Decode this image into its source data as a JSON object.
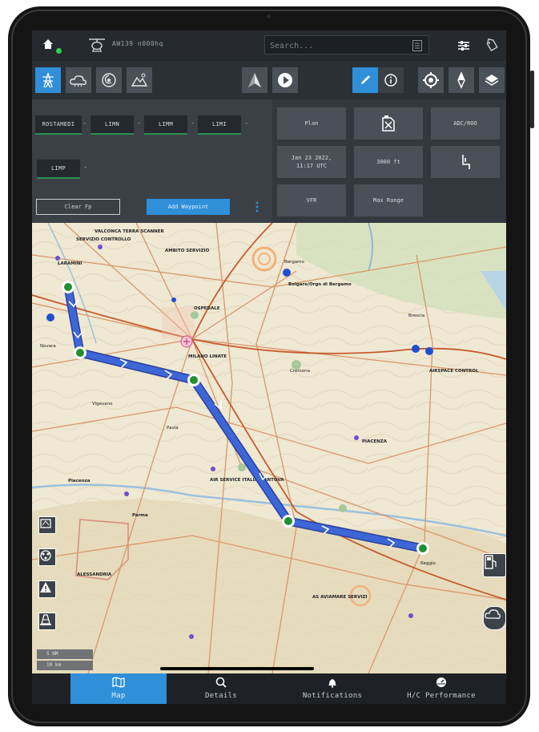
{
  "topbar": {
    "aircraft_label": "AW139 n000hq",
    "search_placeholder": "Search..."
  },
  "toolbar": {
    "icons": [
      "power-lines-icon",
      "clouds-icon",
      "hurricane-icon",
      "terrain-icon",
      "north-arrow-icon",
      "play-icon",
      "pencil-icon",
      "info-icon",
      "target-icon",
      "compass-icon",
      "layers-icon"
    ]
  },
  "route": {
    "waypoints": [
      "ROSTAMEDI",
      "LIMN",
      "LIMM",
      "LIMI",
      "LIMP"
    ],
    "clear_fp": "Clear Fp",
    "add_waypoint": "Add Waypoint"
  },
  "settings": {
    "flight_plan": "Plan",
    "date": "Jan 23 2022,",
    "time": "11:17 UTC",
    "altitude": "3000 ft",
    "rules": "VFR",
    "range": "Max Range",
    "airport_codes": "ADC/ROO"
  },
  "map": {
    "labels": [
      "VALCONCA TERRA SCANNER",
      "SERVIZIO CONTROLLO",
      "AMBITO SERVIZIO",
      "Bergamo",
      "Bolgare/Orgn di Bergamo",
      "Brescia",
      "Novara",
      "LARAMINI",
      "Vigevano",
      "Pavia",
      "OSPEDALE",
      "PIACENZA",
      "AIR SERVICE ITALIA MANTOVA",
      "MILANO LINATE",
      "Cremona",
      "Piacenza",
      "Parma",
      "AIRSPACE CONTROL",
      "ALESSANDRIA",
      "AS AVIAMARE SERVIZI",
      "Reggio"
    ],
    "scale_top": "5 NM",
    "scale_bottom": "10 km"
  },
  "nav": {
    "map": "Map",
    "details": "Details",
    "notifications": "Notifications",
    "performance": "H/C Performance"
  },
  "colors": {
    "accent": "#2f8fd8",
    "route": "#3a5fcf",
    "waypoint": "#1f8f32",
    "status_ok": "#2fd24a"
  }
}
